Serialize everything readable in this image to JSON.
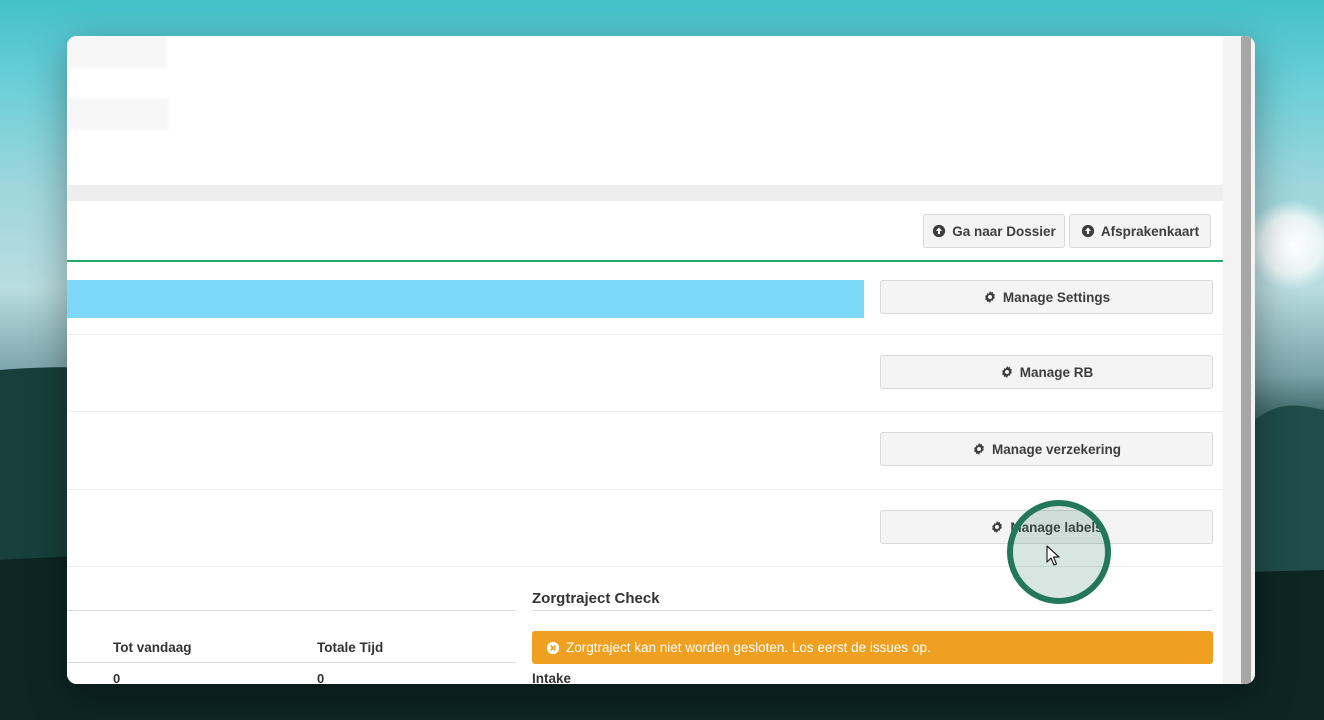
{
  "header": {
    "dossier_button": "Ga naar Dossier",
    "afspraken_button": "Afsprakenkaart"
  },
  "manage": {
    "settings": "Manage Settings",
    "rb": "Manage RB",
    "verzekering": "Manage verzekering",
    "labels": "Manage labels"
  },
  "progress": {
    "fill_fraction": 1.0,
    "color": "#7dd8f8"
  },
  "table": {
    "columns": [
      "Tot vandaag",
      "Totale Tijd"
    ],
    "row": [
      "0",
      "0"
    ]
  },
  "check": {
    "title": "Zorgtraject Check",
    "alert": "Zorgtraject kan niet worden gesloten. Los eerst de issues op.",
    "first_item": "Intake"
  },
  "colors": {
    "accent_green": "#23a86b",
    "alert_orange": "#f0a020",
    "cursor_ring": "#23775a"
  }
}
